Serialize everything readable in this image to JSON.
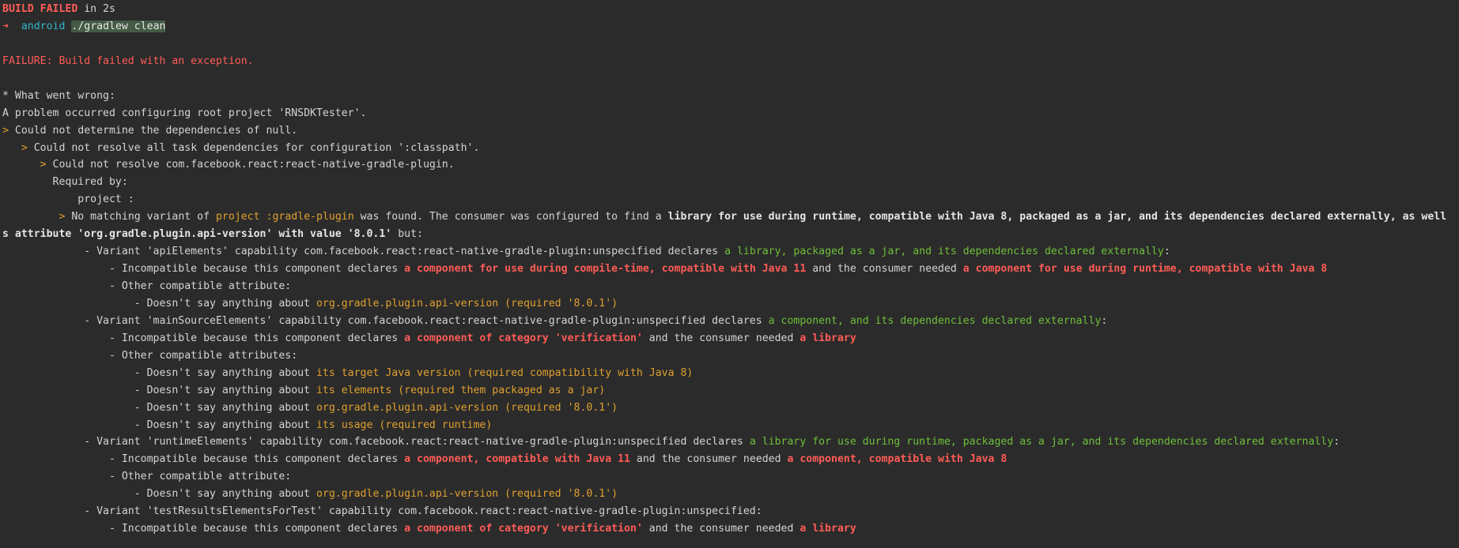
{
  "window": {
    "kind": "terminal-output",
    "accent_colors": {
      "error": "#ff5c57",
      "warning": "#e0a030",
      "ok": "#6fbf3a",
      "path": "#2fb7c8",
      "background": "#2b2b2b",
      "foreground": "#d4d4d4"
    }
  },
  "lines": [
    {
      "segs": [
        {
          "t": "BUILD FAILED",
          "c": "redbold"
        },
        {
          "t": " in 2s",
          "c": "default"
        }
      ]
    },
    {
      "segs": [
        {
          "t": "➜",
          "c": "arrow"
        },
        {
          "t": "  ",
          "c": "default"
        },
        {
          "t": "android",
          "c": "cyan"
        },
        {
          "t": " ",
          "c": "default"
        },
        {
          "t": "./gradlew clean",
          "c": "cmd"
        }
      ]
    },
    {
      "segs": []
    },
    {
      "segs": [
        {
          "t": "FAILURE: Build failed with an exception.",
          "c": "red"
        }
      ]
    },
    {
      "segs": []
    },
    {
      "segs": [
        {
          "t": "* What went wrong:",
          "c": "default"
        }
      ]
    },
    {
      "segs": [
        {
          "t": "A problem occurred configuring root project 'RNSDKTester'.",
          "c": "default"
        }
      ]
    },
    {
      "segs": [
        {
          "t": "> ",
          "c": "yellow"
        },
        {
          "t": "Could not determine the dependencies of null.",
          "c": "default"
        }
      ]
    },
    {
      "segs": [
        {
          "t": "   ",
          "c": "default"
        },
        {
          "t": "> ",
          "c": "yellow"
        },
        {
          "t": "Could not resolve all task dependencies for configuration ':classpath'.",
          "c": "default"
        }
      ]
    },
    {
      "segs": [
        {
          "t": "      ",
          "c": "default"
        },
        {
          "t": "> ",
          "c": "yellow"
        },
        {
          "t": "Could not resolve com.facebook.react:react-native-gradle-plugin.",
          "c": "default"
        }
      ]
    },
    {
      "segs": [
        {
          "t": "        Required by:",
          "c": "default"
        }
      ]
    },
    {
      "segs": [
        {
          "t": "            project :",
          "c": "default"
        }
      ]
    },
    {
      "segs": [
        {
          "t": "         ",
          "c": "default"
        },
        {
          "t": "> ",
          "c": "yellow"
        },
        {
          "t": "No matching variant of ",
          "c": "default"
        },
        {
          "t": "project :gradle-plugin",
          "c": "yellow"
        },
        {
          "t": " was found. The consumer was configured to find a ",
          "c": "default"
        },
        {
          "t": "library for use during runtime, compatible with Java 8, packaged as a jar, and its dependencies declared externally, as well",
          "c": "bold"
        }
      ]
    },
    {
      "segs": [
        {
          "t": "s attribute 'org.gradle.plugin.api-version' with value '8.0.1'",
          "c": "bold"
        },
        {
          "t": " but:",
          "c": "default"
        }
      ]
    },
    {
      "segs": [
        {
          "t": "             - Variant 'apiElements' capability com.facebook.react:react-native-gradle-plugin:unspecified declares ",
          "c": "default"
        },
        {
          "t": "a library, packaged as a jar, and its dependencies declared externally",
          "c": "green"
        },
        {
          "t": ":",
          "c": "default"
        }
      ]
    },
    {
      "segs": [
        {
          "t": "                 - Incompatible because this component declares ",
          "c": "default"
        },
        {
          "t": "a component for use during compile-time, compatible with Java 11",
          "c": "redbold"
        },
        {
          "t": " and the consumer needed ",
          "c": "default"
        },
        {
          "t": "a component for use during runtime, compatible with Java 8",
          "c": "redbold"
        }
      ]
    },
    {
      "segs": [
        {
          "t": "                 - Other compatible attribute:",
          "c": "default"
        }
      ]
    },
    {
      "segs": [
        {
          "t": "                     - Doesn't say anything about ",
          "c": "default"
        },
        {
          "t": "org.gradle.plugin.api-version (required '8.0.1')",
          "c": "yellow"
        }
      ]
    },
    {
      "segs": [
        {
          "t": "             - Variant 'mainSourceElements' capability com.facebook.react:react-native-gradle-plugin:unspecified declares ",
          "c": "default"
        },
        {
          "t": "a component, and its dependencies declared externally",
          "c": "green"
        },
        {
          "t": ":",
          "c": "default"
        }
      ]
    },
    {
      "segs": [
        {
          "t": "                 - Incompatible because this component declares ",
          "c": "default"
        },
        {
          "t": "a component of category 'verification'",
          "c": "redbold"
        },
        {
          "t": " and the consumer needed ",
          "c": "default"
        },
        {
          "t": "a library",
          "c": "redbold"
        }
      ]
    },
    {
      "segs": [
        {
          "t": "                 - Other compatible attributes:",
          "c": "default"
        }
      ]
    },
    {
      "segs": [
        {
          "t": "                     - Doesn't say anything about ",
          "c": "default"
        },
        {
          "t": "its target Java version (required compatibility with Java 8)",
          "c": "yellow"
        }
      ]
    },
    {
      "segs": [
        {
          "t": "                     - Doesn't say anything about ",
          "c": "default"
        },
        {
          "t": "its elements (required them packaged as a jar)",
          "c": "yellow"
        }
      ]
    },
    {
      "segs": [
        {
          "t": "                     - Doesn't say anything about ",
          "c": "default"
        },
        {
          "t": "org.gradle.plugin.api-version (required '8.0.1')",
          "c": "yellow"
        }
      ]
    },
    {
      "segs": [
        {
          "t": "                     - Doesn't say anything about ",
          "c": "default"
        },
        {
          "t": "its usage (required runtime)",
          "c": "yellow"
        }
      ]
    },
    {
      "segs": [
        {
          "t": "             - Variant 'runtimeElements' capability com.facebook.react:react-native-gradle-plugin:unspecified declares ",
          "c": "default"
        },
        {
          "t": "a library for use during runtime, packaged as a jar, and its dependencies declared externally",
          "c": "green"
        },
        {
          "t": ":",
          "c": "default"
        }
      ]
    },
    {
      "segs": [
        {
          "t": "                 - Incompatible because this component declares ",
          "c": "default"
        },
        {
          "t": "a component, compatible with Java 11",
          "c": "redbold"
        },
        {
          "t": " and the consumer needed ",
          "c": "default"
        },
        {
          "t": "a component, compatible with Java 8",
          "c": "redbold"
        }
      ]
    },
    {
      "segs": [
        {
          "t": "                 - Other compatible attribute:",
          "c": "default"
        }
      ]
    },
    {
      "segs": [
        {
          "t": "                     - Doesn't say anything about ",
          "c": "default"
        },
        {
          "t": "org.gradle.plugin.api-version (required '8.0.1')",
          "c": "yellow"
        }
      ]
    },
    {
      "segs": [
        {
          "t": "             - Variant 'testResultsElementsForTest' capability com.facebook.react:react-native-gradle-plugin:unspecified:",
          "c": "default"
        }
      ]
    },
    {
      "segs": [
        {
          "t": "                 - Incompatible because this component declares ",
          "c": "default"
        },
        {
          "t": "a component of category 'verification'",
          "c": "redbold"
        },
        {
          "t": " and the consumer needed ",
          "c": "default"
        },
        {
          "t": "a library",
          "c": "redbold"
        }
      ]
    }
  ]
}
